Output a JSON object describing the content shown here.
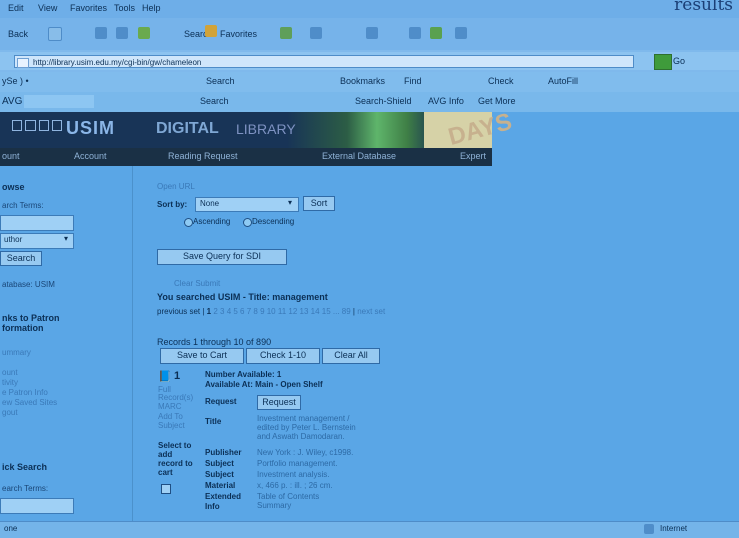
{
  "browser": {
    "menubar": [
      "Edit",
      "View",
      "Favorites",
      "Tools",
      "Help"
    ],
    "results_label": "results",
    "toolbar_back": "Back",
    "toolbar_search": "Search",
    "toolbar_favorites": "Favorites",
    "address": "http://library.usim.edu.my/cgi-bin/gw/chameleon",
    "go": "Go",
    "toolbar3_left": "ySe ) •",
    "toolbar3_search": "Search",
    "toolbar3_bookmarks": "Bookmarks",
    "toolbar3_find": "Find",
    "toolbar3_check": "Check",
    "toolbar3_autofill": "AutoFill",
    "toolbar4_left": "AVG",
    "toolbar4_search": "Search",
    "toolbar4_search_shield": "Search-Shield",
    "toolbar4_avg_info": "AVG Info",
    "toolbar4_get_more": "Get More",
    "status_left": "one",
    "status_right": "Internet"
  },
  "banner": {
    "usim": "USIM",
    "digital": "DIGITAL",
    "library": "LIBRARY",
    "days": "DAYS"
  },
  "nav": [
    "ount",
    "Account",
    "Reading Request",
    "External Database",
    "Expert"
  ],
  "left": {
    "browse": "owse",
    "search_terms": "arch Terms:",
    "author": "uthor",
    "search_button": "Search",
    "database": "atabase: USIM",
    "links_title_1": "nks to Patron",
    "links_title_2": "formation",
    "links": [
      "ummary",
      "",
      "ount",
      "tivity",
      "e Patron Info",
      "ew Saved Sites",
      "gout"
    ],
    "quick_search": "ick Search",
    "quick_terms": "earch Terms:"
  },
  "main": {
    "open_url": "Open URL",
    "sort_label": "Sort by:",
    "sort_value": "None",
    "sort_button": "Sort",
    "ascending": "Ascending",
    "descending": "Descending",
    "save_query": "Save Query for SDI",
    "clear_submit": "Clear Submit",
    "you_searched": "You searched USIM - Title: management",
    "pagination_prev": "previous set",
    "pagination_current": "1",
    "pagination_pages": "2 3 4 5 6 7 8 9 10 11 12 13 14 15 ... 89",
    "pagination_next": "next set",
    "records": "Records 1 through 10 of 890",
    "save_to_cart": "Save to Cart",
    "check_1_10": "Check 1-10",
    "clear_all": "Clear All",
    "record_number": "1",
    "left_small_1": "Full",
    "left_small_2": "Record(s)",
    "left_small_3": "MARC",
    "left_small_4": "Add To",
    "left_small_5": "Subject",
    "select_to_add": "Select to add record to cart",
    "number_available": "Number Available: 1",
    "available_at": "Available At: Main - Open Shelf",
    "request_label": "Request",
    "request_button": "Request",
    "title_label": "Title",
    "title_value": "Investment management / edited by Peter L. Bernstein and Aswath Damodaran.",
    "publisher_label": "Publisher",
    "publisher_value": "New York : J. Wiley, c1998.",
    "subject_label_1": "Subject",
    "subject_value_1": "Portfolio management.",
    "subject_label_2": "Subject",
    "subject_value_2": "Investment analysis.",
    "material_label": "Material",
    "material_value": "x, 466 p. : ill. ; 26 cm.",
    "extended_label": "Extended",
    "extended_info": "Info",
    "extended_value": "Table of Contents Summary"
  },
  "colors": {
    "background": "#5aa6e6",
    "banner": "#183457",
    "nav": "#1a3045",
    "button": "#96c9f1"
  }
}
